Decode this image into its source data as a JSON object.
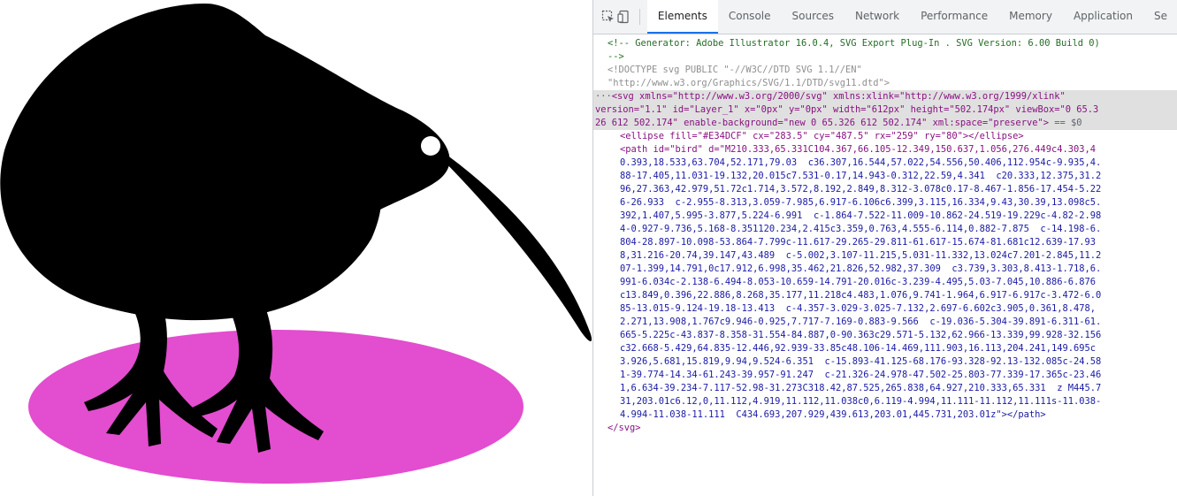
{
  "toolbar": {
    "inspect_icon": "inspect-element-icon",
    "device_icon": "device-toggle-icon",
    "tabs": [
      {
        "label": "Elements",
        "active": true
      },
      {
        "label": "Console"
      },
      {
        "label": "Sources"
      },
      {
        "label": "Network"
      },
      {
        "label": "Performance"
      },
      {
        "label": "Memory"
      },
      {
        "label": "Application"
      },
      {
        "label": "Se"
      }
    ]
  },
  "colors": {
    "ellipse_fill": "#E34DCF",
    "bird_fill": "#000000",
    "eye_fill": "#FFFFFF",
    "active_tab_underline": "#1a73e8"
  },
  "elements": {
    "comment_line1": "<!-- Generator: Adobe Illustrator 16.0.4, SVG Export Plug-In . SVG Version: 6.00 Build 0)",
    "comment_line2": "-->",
    "doctype_line1": "<!DOCTYPE svg PUBLIC \"-//W3C//DTD SVG 1.1//EN\"",
    "doctype_line2": "\"http://www.w3.org/Graphics/SVG/1.1/DTD/svg11.dtd\">",
    "svg_line1": "<svg xmlns=\"http://www.w3.org/2000/svg\" xmlns:xlink=\"http://www.w3.org/1999/xlink\"",
    "svg_line2": "version=\"1.1\" id=\"Layer_1\" x=\"0px\" y=\"0px\" width=\"612px\" height=\"502.174px\" viewBox=\"0 65.3",
    "svg_line3": "26 612 502.174\" enable-background=\"new 0 65.326 612 502.174\" xml:space=\"preserve\">",
    "svg_selected_marker": "== $0",
    "ellipse_line": "<ellipse fill=\"#E34DCF\" cx=\"283.5\" cy=\"487.5\" rx=\"259\" ry=\"80\"></ellipse>",
    "path_lines": [
      "<path id=\"bird\" d=\"M210.333,65.331C104.367,66.105-12.349,150.637,1.056,276.449c4.303,4",
      "0.393,18.533,63.704,52.171,79.03  c36.307,16.544,57.022,54.556,50.406,112.954c-9.935,4.",
      "88-17.405,11.031-19.132,20.015c7.531-0.17,14.943-0.312,22.59,4.341  c20.333,12.375,31.2",
      "96,27.363,42.979,51.72c1.714,3.572,8.192,2.849,8.312-3.078c0.17-8.467-1.856-17.454-5.22",
      "6-26.933  c-2.955-8.313,3.059-7.985,6.917-6.106c6.399,3.115,16.334,9.43,30.39,13.098c5.",
      "392,1.407,5.995-3.877,5.224-6.991  c-1.864-7.522-11.009-10.862-24.519-19.229c-4.82-2.98",
      "4-0.927-9.736,5.168-8.351120.234,2.415c3.359,0.763,4.555-6.114,0.882-7.875  c-14.198-6.",
      "804-28.897-10.098-53.864-7.799c-11.617-29.265-29.811-61.617-15.674-81.681c12.639-17.93",
      "8,31.216-20.74,39.147,43.489  c-5.002,3.107-11.215,5.031-11.332,13.024c7.201-2.845,11.2",
      "07-1.399,14.791,0c17.912,6.998,35.462,21.826,52.982,37.309  c3.739,3.303,8.413-1.718,6.",
      "991-6.034c-2.138-6.494-8.053-10.659-14.791-20.016c-3.239-4.495,5.03-7.045,10.886-6.876",
      "c13.849,0.396,22.886,8.268,35.177,11.218c4.483,1.076,9.741-1.964,6.917-6.917c-3.472-6.0",
      "85-13.015-9.124-19.18-13.413  c-4.357-3.029-3.025-7.132,2.697-6.602c3.905,0.361,8.478,",
      "2.271,13.908,1.767c9.946-0.925,7.717-7.169-0.883-9.566  c-19.036-5.304-39.891-6.311-61.",
      "665-5.225c-43.837-8.358-31.554-84.887,0-90.363c29.571-5.132,62.966-13.339,99.928-32.156",
      "c32.668-5.429,64.835-12.446,92.939-33.85c48.106-14.469,111.903,16.113,204.241,149.695c",
      "3.926,5.681,15.819,9.94,9.524-6.351  c-15.893-41.125-68.176-93.328-92.13-132.085c-24.58",
      "1-39.774-14.34-61.243-39.957-91.247  c-21.326-24.978-47.502-25.803-77.339-17.365c-23.46",
      "1,6.634-39.234-7.117-52.98-31.273C318.42,87.525,265.838,64.927,210.333,65.331  z M445.7",
      "31,203.01c6.12,0,11.112,4.919,11.112,11.038c0,6.119-4.994,11.111-11.112,11.111s-11.038-",
      "4.994-11.038-11.111  C434.693,207.929,439.613,203.01,445.731,203.01z\"></path>"
    ],
    "svg_close": "</svg>"
  }
}
